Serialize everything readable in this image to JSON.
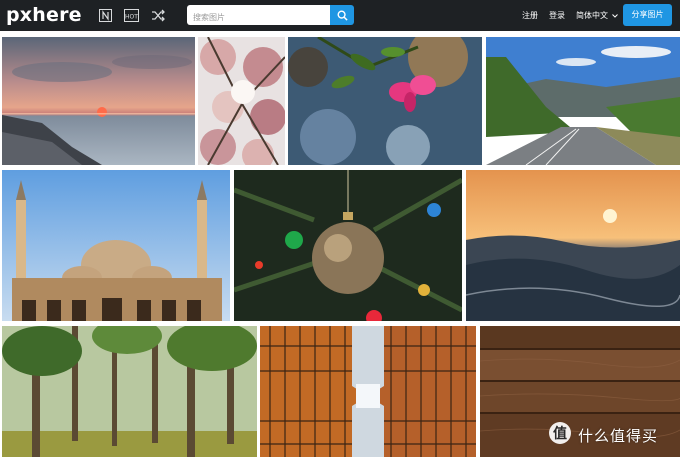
{
  "topbar": {
    "logo": "pxhere",
    "search_placeholder": "搜索图片",
    "register": "注册",
    "login": "登录",
    "language": "简体中文",
    "share_button": "分享图片"
  },
  "gallery": {
    "photos": [
      {
        "subject": "Sunset over the sea with rocky shore"
      },
      {
        "subject": "Pink magnolia blossoms against the sky"
      },
      {
        "subject": "Pink flower with green leaves, blurred background"
      },
      {
        "subject": "Mountain road winding between green hills"
      },
      {
        "subject": "Mosque with minarets under blue sky"
      },
      {
        "subject": "Glitter Christmas ornament on a tree"
      },
      {
        "subject": "Sun setting over ocean waves"
      },
      {
        "subject": "Misty green forest"
      },
      {
        "subject": "Looking up between glass skyscrapers"
      },
      {
        "subject": "Dark brown wooden planks"
      }
    ]
  },
  "watermark": {
    "text": "什么值得买"
  },
  "colors": {
    "topbar": "#1e2124",
    "accent": "#1f96e3"
  }
}
